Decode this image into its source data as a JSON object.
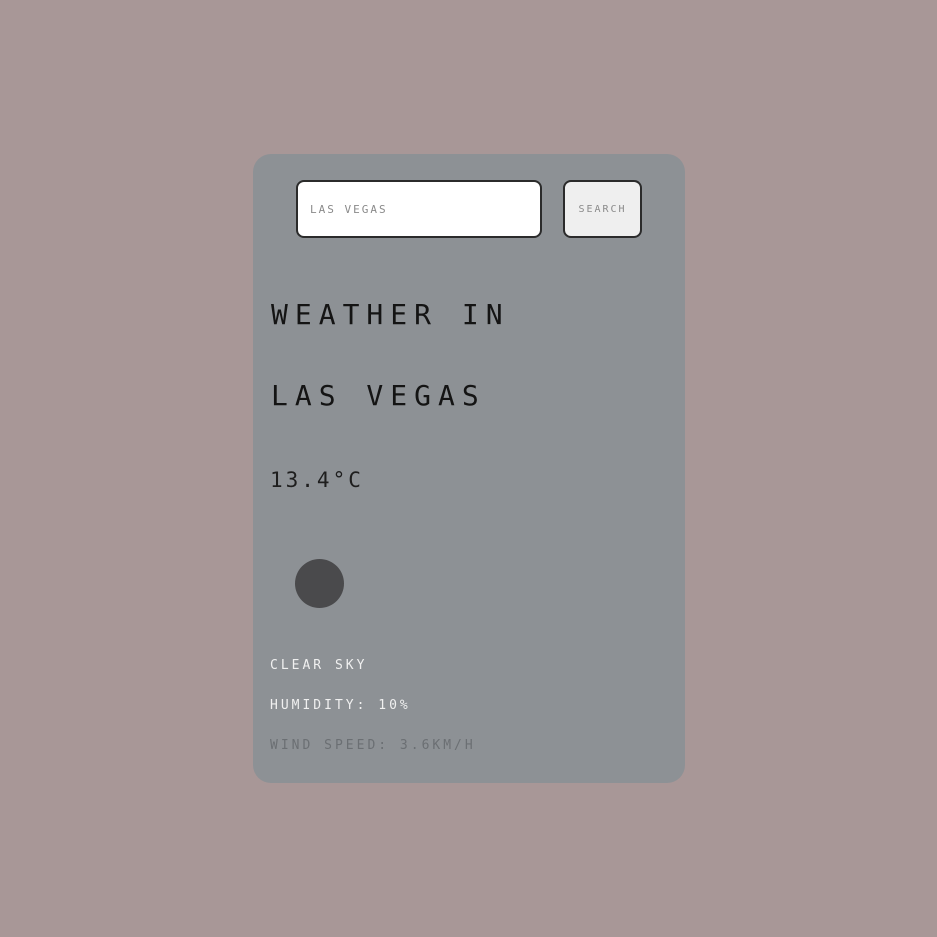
{
  "search": {
    "placeholder": "Las Vegas",
    "button_label": "Search"
  },
  "weather": {
    "title": "Weather in Las Vegas",
    "temperature": "13.4°C",
    "icon": "weather-icon",
    "description": "Clear sky",
    "humidity": "Humidity: 10%",
    "wind": "Wind speed: 3.6km/h"
  },
  "colors": {
    "background": "#a89797",
    "card": "#8d9195",
    "icon": "#4a4a4c"
  }
}
